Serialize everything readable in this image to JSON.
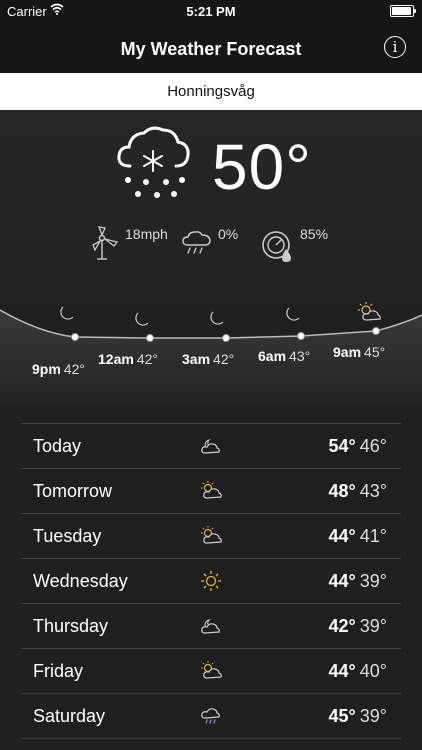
{
  "status_bar": {
    "carrier": "Carrier",
    "time": "5:21 PM"
  },
  "nav": {
    "title": "My Weather Forecast",
    "info_icon": "info-icon"
  },
  "location": "Honningsvåg",
  "current": {
    "icon": "snow-cloud-icon",
    "temperature": "50°",
    "wind": "18mph",
    "precipitation": "0%",
    "humidity": "85%"
  },
  "hourly": [
    {
      "time": "9pm",
      "temp": "42°",
      "icon": "moon-icon"
    },
    {
      "time": "12am",
      "temp": "42°",
      "icon": "moon-icon"
    },
    {
      "time": "3am",
      "temp": "42°",
      "icon": "moon-icon"
    },
    {
      "time": "6am",
      "temp": "43°",
      "icon": "moon-icon"
    },
    {
      "time": "9am",
      "temp": "45°",
      "icon": "partly-sunny-icon"
    }
  ],
  "daily": [
    {
      "day": "Today",
      "high": "54°",
      "low": "46°",
      "icon": "night-cloudy-icon"
    },
    {
      "day": "Tomorrow",
      "high": "48°",
      "low": "43°",
      "icon": "partly-sunny-icon"
    },
    {
      "day": "Tuesday",
      "high": "44°",
      "low": "41°",
      "icon": "partly-sunny-icon"
    },
    {
      "day": "Wednesday",
      "high": "44°",
      "low": "39°",
      "icon": "sun-icon"
    },
    {
      "day": "Thursday",
      "high": "42°",
      "low": "39°",
      "icon": "night-cloudy-icon"
    },
    {
      "day": "Friday",
      "high": "44°",
      "low": "40°",
      "icon": "partly-sunny-icon"
    },
    {
      "day": "Saturday",
      "high": "45°",
      "low": "39°",
      "icon": "rain-cloud-icon"
    }
  ],
  "colors": {
    "sun": "#e8b23a",
    "rain": "#8a7fd6",
    "background": "#1f1f1f"
  }
}
